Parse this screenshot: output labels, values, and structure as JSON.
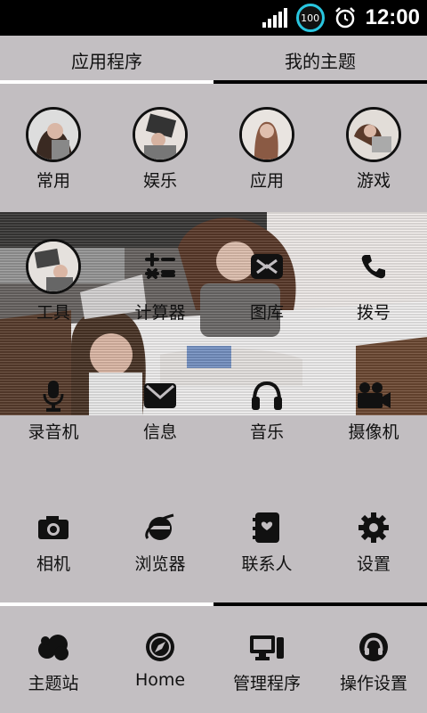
{
  "statusbar": {
    "battery": "100",
    "time": "12:00"
  },
  "tabs": [
    {
      "label": "应用程序",
      "active": true
    },
    {
      "label": "我的主题",
      "active": false
    }
  ],
  "categories": [
    {
      "label": "常用",
      "icon": "photo-avatar-icon"
    },
    {
      "label": "娱乐",
      "icon": "photo-avatar-icon"
    },
    {
      "label": "应用",
      "icon": "photo-avatar-icon"
    },
    {
      "label": "游戏",
      "icon": "photo-avatar-icon"
    }
  ],
  "banner_row": [
    {
      "label": "工具",
      "icon": "photo-avatar-icon"
    },
    {
      "label": "计算器",
      "icon": "calculator-icon"
    },
    {
      "label": "图库",
      "icon": "gallery-icon"
    },
    {
      "label": "拨号",
      "icon": "phone-icon"
    }
  ],
  "row2": [
    {
      "label": "录音机",
      "icon": "microphone-icon"
    },
    {
      "label": "信息",
      "icon": "message-icon"
    },
    {
      "label": "音乐",
      "icon": "headphones-icon"
    },
    {
      "label": "摄像机",
      "icon": "video-camera-icon"
    }
  ],
  "row3": [
    {
      "label": "相机",
      "icon": "camera-icon"
    },
    {
      "label": "浏览器",
      "icon": "browser-icon"
    },
    {
      "label": "联系人",
      "icon": "contacts-icon"
    },
    {
      "label": "设置",
      "icon": "gear-icon"
    }
  ],
  "dock": [
    {
      "label": "主题站",
      "icon": "cloud-icon"
    },
    {
      "label": "Home",
      "icon": "compass-icon"
    },
    {
      "label": "管理程序",
      "icon": "monitor-icon"
    },
    {
      "label": "操作设置",
      "icon": "headset-icon"
    }
  ],
  "colors": {
    "background": "#c2bec1",
    "tab_active_bar": "#ffffff",
    "tab_inactive_bar": "#000000",
    "statusbar": "#000000",
    "battery_ring": "#29c6e0"
  }
}
